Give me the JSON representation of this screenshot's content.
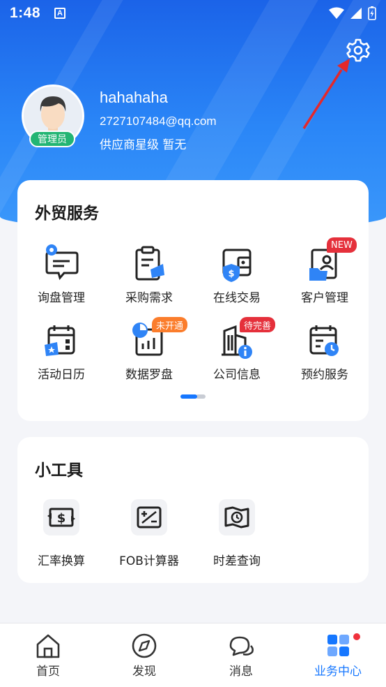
{
  "status_bar": {
    "time": "1:48",
    "a_icon_letter": "A"
  },
  "profile": {
    "name": "hahahaha",
    "email": "2727107484@qq.com",
    "level": "供应商星级 暂无",
    "role_badge": "管理员"
  },
  "trade_services": {
    "title": "外贸服务",
    "items": [
      {
        "label": "询盘管理",
        "icon": "inquiry-icon"
      },
      {
        "label": "采购需求",
        "icon": "purchase-icon"
      },
      {
        "label": "在线交易",
        "icon": "wallet-icon"
      },
      {
        "label": "客户管理",
        "icon": "customer-icon",
        "tag": "NEW"
      },
      {
        "label": "活动日历",
        "icon": "calendar-icon"
      },
      {
        "label": "数据罗盘",
        "icon": "chart-icon",
        "tag": "未开通"
      },
      {
        "label": "公司信息",
        "icon": "company-icon",
        "tag": "待完善"
      },
      {
        "label": "预约服务",
        "icon": "schedule-icon"
      }
    ]
  },
  "tools": {
    "title": "小工具",
    "items": [
      {
        "label": "汇率换算",
        "icon": "exchange-icon"
      },
      {
        "label": "FOB计算器",
        "icon": "calculator-icon"
      },
      {
        "label": "时差查询",
        "icon": "timezone-icon"
      }
    ]
  },
  "bottom_nav": [
    {
      "label": "首页",
      "icon": "home-icon"
    },
    {
      "label": "发现",
      "icon": "compass-icon"
    },
    {
      "label": "消息",
      "icon": "message-icon"
    },
    {
      "label": "业务中心",
      "icon": "grid-icon",
      "active": true
    }
  ],
  "colors": {
    "primary": "#1677ff",
    "header": "#2a86f7",
    "green": "#22b573",
    "red": "#e5303b",
    "orange": "#fb7d2c"
  }
}
